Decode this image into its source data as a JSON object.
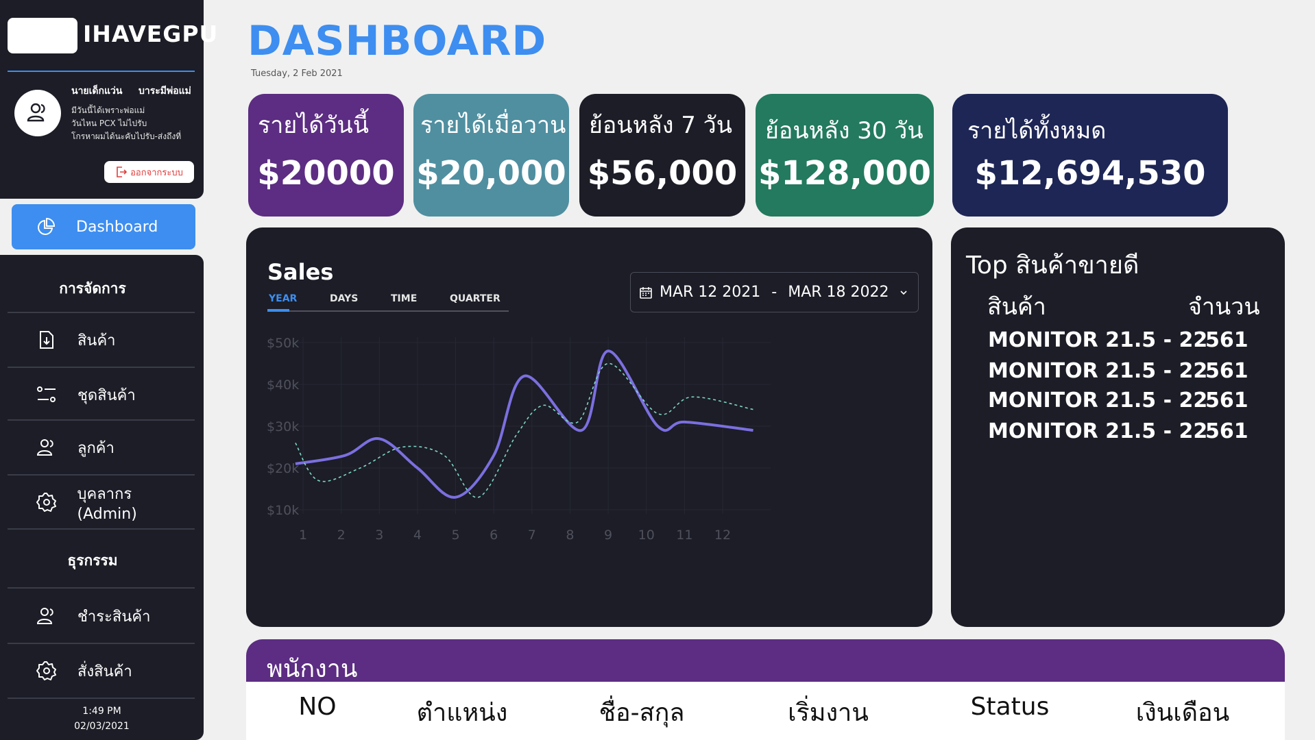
{
  "brand": "IHAVEGPU",
  "user": {
    "first_name": "นายเด็กแว่น",
    "last_name": "บาระมีพ่อแม่",
    "bio": [
      "มีวันนี้ได้เพราะพ่อแม่",
      "วันไหน PCX ไม่ไปรับ",
      "โกรหาผมได้นะคับไปรับ-ส่งถึงที่"
    ],
    "logout_label": "ออกจากระบบ"
  },
  "nav": {
    "dashboard_label": "Dashboard",
    "section_manage": "การจัดการ",
    "manage_items": [
      {
        "label": "สินค้า",
        "icon": "file-download-icon"
      },
      {
        "label": "ชุดสินค้า",
        "icon": "sliders-icon"
      },
      {
        "label": "ลูกค้า",
        "icon": "users-icon"
      },
      {
        "label": "บุคลากร (Admin)",
        "icon": "gear-icon"
      }
    ],
    "section_business": "ธุรกรรม",
    "business_items": [
      {
        "label": "ชำระสินค้า",
        "icon": "users-icon"
      },
      {
        "label": "สั่งสินค้า",
        "icon": "gear-icon"
      }
    ]
  },
  "clock": {
    "time": "1:49 PM",
    "date": "02/03/2021"
  },
  "header": {
    "title": "DASHBOARD",
    "date": "Tuesday, 2 Feb 2021"
  },
  "stats": [
    {
      "label": "รายได้วันนี้",
      "value": "$20000",
      "color": "#5c2d82"
    },
    {
      "label": "รายได้เมื่อวาน",
      "value": "$20,000",
      "color": "#4f8fa0"
    },
    {
      "label": "ย้อนหลัง 7 วัน",
      "value": "$56,000",
      "color": "#1c1d26"
    },
    {
      "label": "ย้อนหลัง 30 วัน",
      "value": "$128,000",
      "color": "#237a5e"
    },
    {
      "label": "รายได้ทั้งหมด",
      "value": "$12,694,530",
      "color": "#1e2656"
    }
  ],
  "sales": {
    "title": "Sales",
    "tabs": [
      "YEAR",
      "DAYS",
      "TIME",
      "QUARTER"
    ],
    "active_tab": "YEAR",
    "range_start": "MAR 12 2021",
    "range_sep": "-",
    "range_end": "MAR 18 2022"
  },
  "chart_data": {
    "type": "line",
    "x": [
      0.8,
      1,
      2,
      3,
      4,
      5,
      6,
      7,
      8,
      9,
      10,
      11,
      12,
      12.8
    ],
    "xticks": [
      "1",
      "2",
      "3",
      "4",
      "5",
      "6",
      "7",
      "8",
      "9",
      "10",
      "11",
      "12"
    ],
    "yticks": [
      "$10k",
      "$20k",
      "$30k",
      "$40k",
      "$50k"
    ],
    "ylim": [
      10,
      50
    ],
    "grid": true,
    "series": [
      {
        "style": "solid",
        "color": "#7b6fe0",
        "values": [
          21,
          23,
          27,
          20,
          13,
          23,
          42,
          29,
          48,
          30,
          31,
          29
        ]
      },
      {
        "style": "dashed",
        "color": "#7ed6c8",
        "values": [
          26,
          17,
          20,
          25,
          23,
          13,
          28,
          35,
          31,
          45,
          33,
          37,
          34
        ]
      }
    ]
  },
  "top_products": {
    "title": "Top สินค้าขายดี",
    "col_product": "สินค้า",
    "col_qty": "จำนวน",
    "rows": [
      {
        "name": "MONITOR 21.5 - 22",
        "qty": "561"
      },
      {
        "name": "MONITOR 21.5 - 22",
        "qty": "561"
      },
      {
        "name": "MONITOR 21.5 - 22",
        "qty": "561"
      },
      {
        "name": "MONITOR 21.5 - 22",
        "qty": "561"
      }
    ]
  },
  "employees": {
    "title": "พนักงาน",
    "columns": [
      "NO",
      "ตำแหน่ง",
      "ชื่อ-สกุล",
      "เริ่มงาน",
      "Status",
      "เงินเดือน"
    ]
  }
}
